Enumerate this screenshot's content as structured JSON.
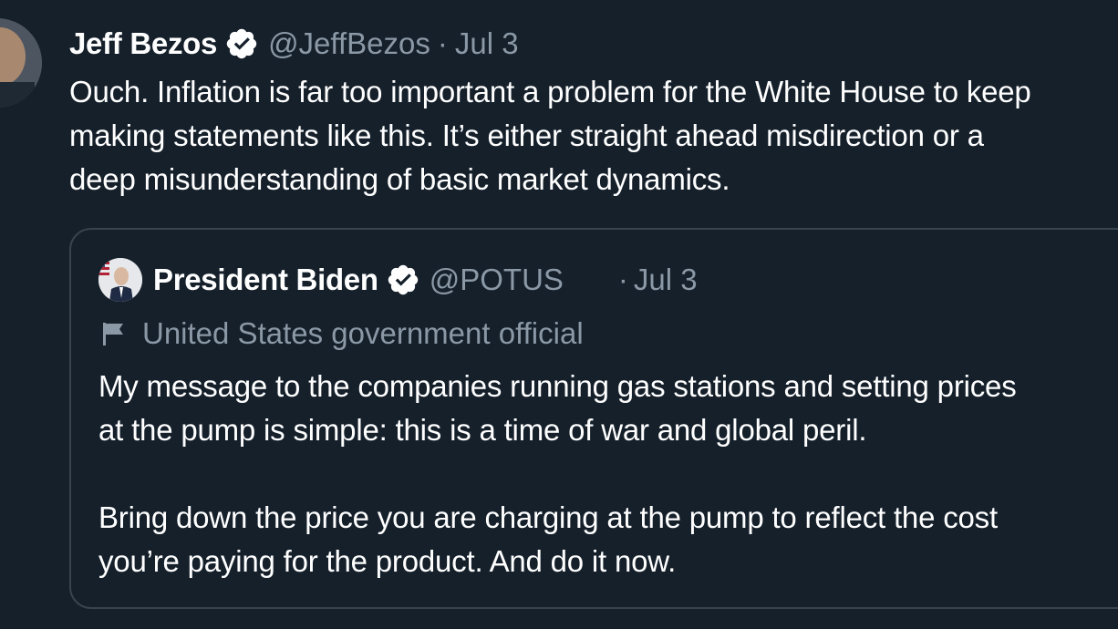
{
  "tweet": {
    "author_name": "Jeff Bezos",
    "handle": "@JeffBezos",
    "separator": "·",
    "date": "Jul 3",
    "text": "Ouch. Inflation is far too important a problem for the White House to keep\nmaking statements like this. It’s either straight ahead misdirection or a\ndeep misunderstanding of basic market dynamics."
  },
  "quoted_tweet": {
    "author_name": "President Biden",
    "handle": "@POTUS",
    "separator": "·",
    "date": "Jul 3",
    "label": "United States government official",
    "text": "My message to the companies running gas stations and setting prices\nat the pump is simple: this is a time of war and global peril.\n\nBring down the price you are charging at the pump to reflect the cost\nyou’re paying for the product. And do it now."
  },
  "icons": {
    "verified": "verified-badge-icon",
    "label": "flag-icon"
  },
  "colors": {
    "background": "#15202b",
    "primary_text": "#ffffff",
    "secondary_text": "#8b98a5",
    "border": "#38444d"
  }
}
